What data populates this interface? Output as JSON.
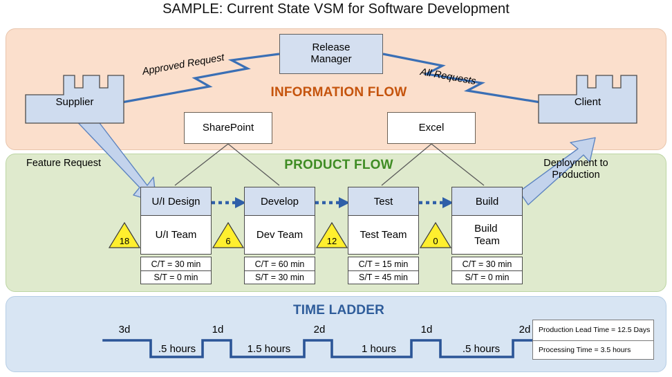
{
  "title": "SAMPLE: Current State VSM for Software Development",
  "panels": {
    "information": {
      "label": "INFORMATION FLOW",
      "color": "#c5540d"
    },
    "product": {
      "label": "PRODUCT FLOW",
      "color": "#3f8c24"
    },
    "time": {
      "label": "TIME LADDER",
      "color": "#2e5c9a"
    }
  },
  "information_flow": {
    "release_manager": "Release\nManager",
    "release_manager_line1": "Release",
    "release_manager_line2": "Manager",
    "supplier": "Supplier",
    "client": "Client",
    "sharepoint": "SharePoint",
    "excel": "Excel",
    "approved_request": "Approved Request",
    "all_requests": "All Requests"
  },
  "product_flow": {
    "feature_request": "Feature Request",
    "deployment_line1": "Deployment to",
    "deployment_line2": "Production",
    "processes": [
      {
        "name": "U/I Design",
        "team": "U/I Team",
        "ct": "C/T = 30 min",
        "st": "S/T = 0 min"
      },
      {
        "name": "Develop",
        "team": "Dev Team",
        "ct": "C/T = 60 min",
        "st": "S/T = 30 min"
      },
      {
        "name": "Test",
        "team": "Test Team",
        "ct": "C/T = 15 min",
        "st": "S/T  = 45 min"
      },
      {
        "name": "Build",
        "team": "Build\nTeam",
        "team_line1": "Build",
        "team_line2": "Team",
        "ct": "C/T = 30 min",
        "st": "S/T = 0 min"
      }
    ],
    "inventory": [
      {
        "value": "18"
      },
      {
        "value": "6"
      },
      {
        "value": "12"
      },
      {
        "value": "0"
      }
    ]
  },
  "time_ladder": {
    "wait_times": [
      "3d",
      "1d",
      "2d",
      "1d",
      "2d"
    ],
    "process_times": [
      ".5 hours",
      "1.5 hours",
      "1 hours",
      ".5 hours"
    ],
    "summary": {
      "lead_time": "Production  Lead Time = 12.5 Days",
      "processing_time": "Processing  Time = 3.5 hours"
    }
  },
  "chart_data": {
    "type": "diagram",
    "title": "SAMPLE: Current State VSM for Software Development",
    "lead_time_days": 12.5,
    "processing_time_hours": 3.5,
    "stages": [
      "U/I Design",
      "Develop",
      "Test",
      "Build"
    ],
    "cycle_times_min": [
      30,
      60,
      15,
      30
    ],
    "setup_times_min": [
      0,
      30,
      45,
      0
    ],
    "inventory_counts": [
      18,
      6,
      12,
      0
    ],
    "wait_days": [
      3,
      1,
      2,
      1,
      2
    ],
    "process_hours": [
      0.5,
      1.5,
      1,
      0.5
    ]
  }
}
